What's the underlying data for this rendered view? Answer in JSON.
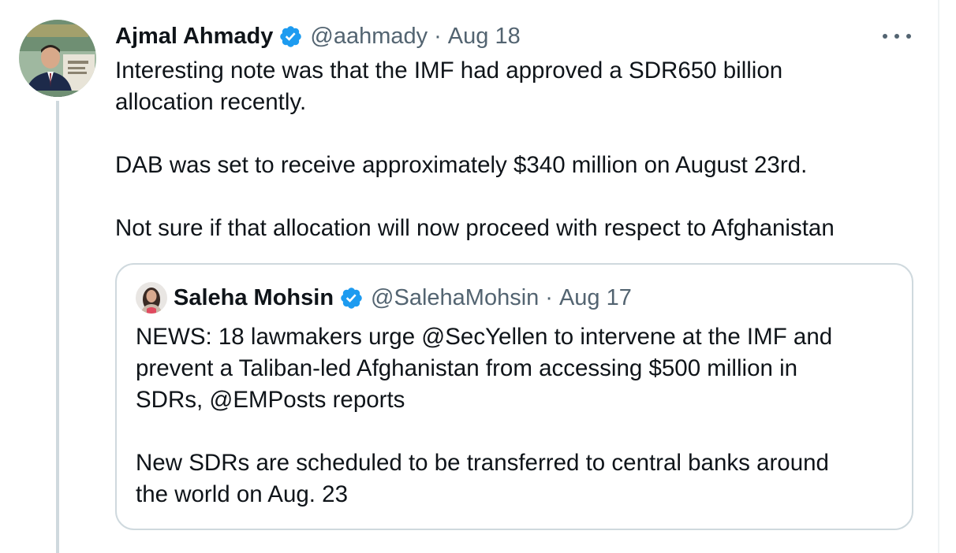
{
  "tweet": {
    "author_name": "Ajmal Ahmady",
    "handle": "@aahmady",
    "separator": "·",
    "date": "Aug 18",
    "text": "Interesting note was that the IMF had approved a SDR650 billion\nallocation recently.\n\nDAB was set to receive approximately $340 million on August 23rd.\n\nNot sure if that allocation will now proceed with respect to Afghanistan",
    "avatar_icon": "profile-photo-icon",
    "verified_icon": "verified-badge-icon",
    "more_icon": "more-options-icon"
  },
  "quoted_tweet": {
    "author_name": "Saleha Mohsin",
    "handle": "@SalehaMohsin",
    "separator": "·",
    "date": "Aug 17",
    "text": "NEWS: 18 lawmakers urge @SecYellen to intervene at the IMF and\nprevent a Taliban-led Afghanistan from accessing  $500 million in\nSDRs, @EMPosts reports\n\nNew SDRs are scheduled to be transferred to central banks around\nthe world on Aug. 23",
    "avatar_icon": "profile-photo-icon",
    "verified_icon": "verified-badge-icon"
  },
  "colors": {
    "text_primary": "#0f1419",
    "text_secondary": "#536471",
    "verified_blue": "#1d9bf0",
    "border": "#cfd9de"
  }
}
